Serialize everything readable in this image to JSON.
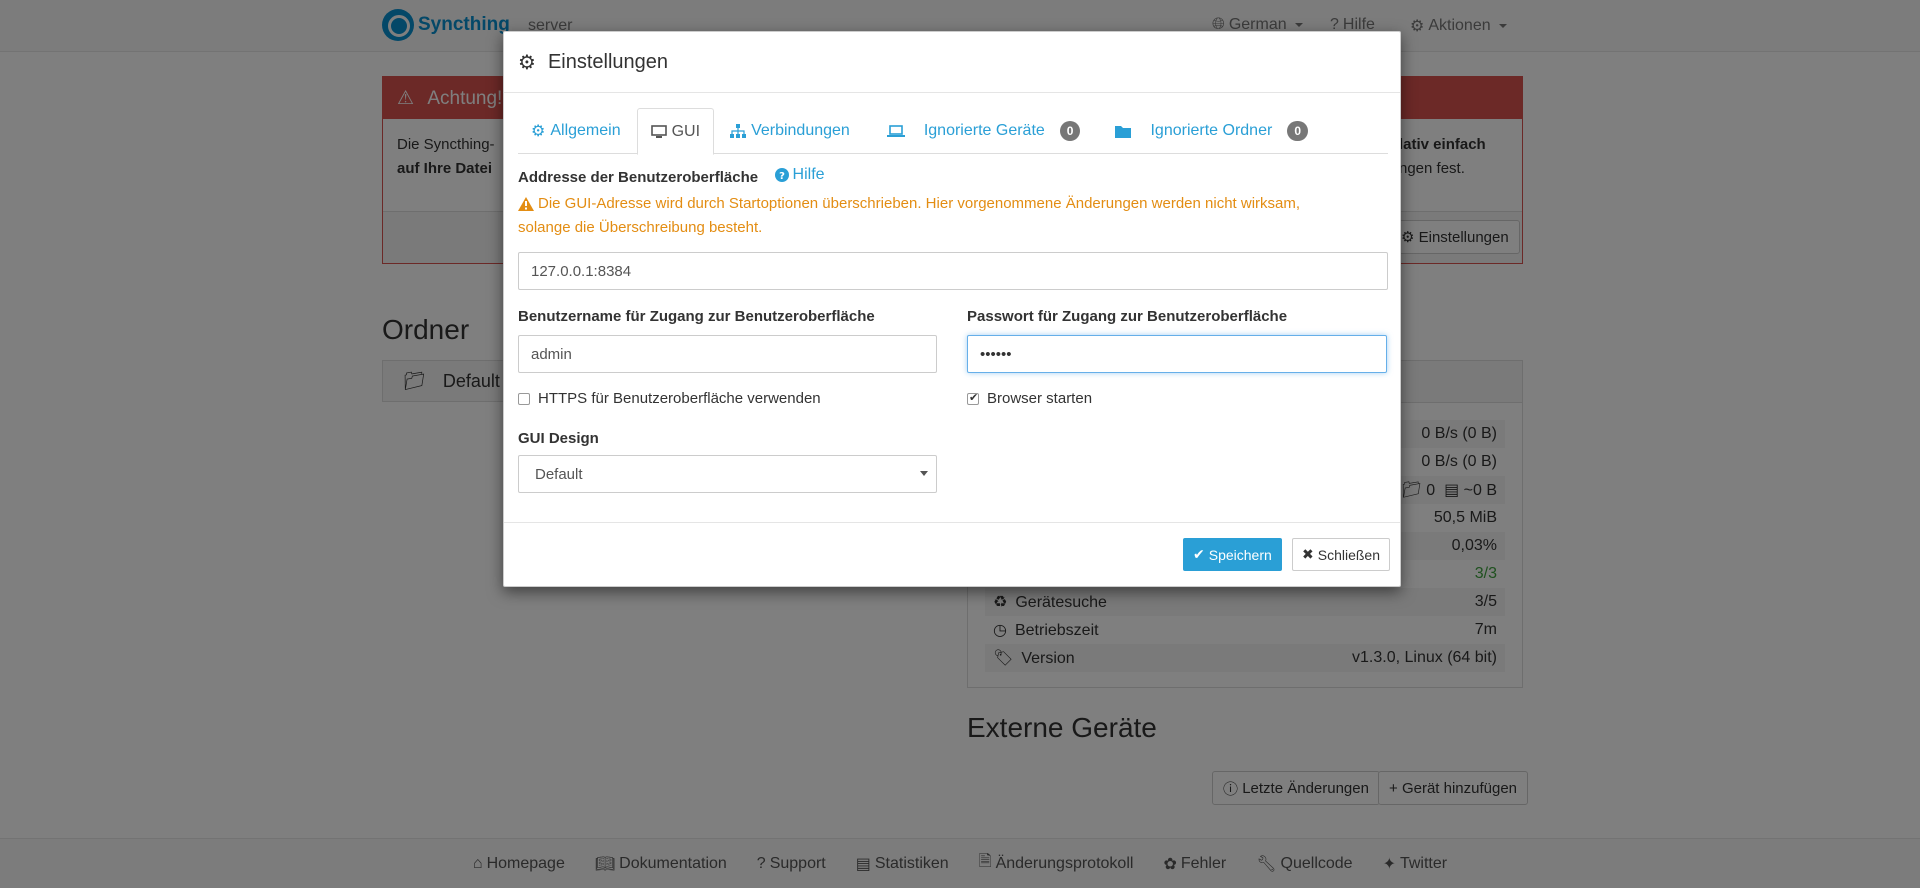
{
  "navbar": {
    "brand": "Syncthing",
    "host": "server",
    "language": "German",
    "help": "Hilfe",
    "actions": "Aktionen"
  },
  "alert": {
    "title": "Achtung!",
    "body_left_1": "Die Syncthing-",
    "body_left_2": "auf Ihre Datei",
    "body_right_1": "lativ einfach",
    "body_right_2": "ngen fest.",
    "settings_button": "Einstellungen"
  },
  "folders": {
    "heading": "Ordner",
    "default_folder": "Default"
  },
  "device": {
    "rows": [
      {
        "label": "",
        "value": "0 B/s (0 B)"
      },
      {
        "label": "",
        "value": "0 B/s (0 B)"
      },
      {
        "label": "",
        "value": "0",
        "value2": "~0 B"
      },
      {
        "label": "",
        "value": "50,5 MiB"
      },
      {
        "label": "",
        "value": "0,03%"
      },
      {
        "label": "",
        "value": "3/3"
      },
      {
        "label": "Gerätesuche",
        "value": "3/5"
      },
      {
        "label": "Betriebszeit",
        "value": "7m"
      },
      {
        "label": "Version",
        "value": "v1.3.0, Linux (64 bit)"
      }
    ]
  },
  "remote": {
    "heading": "Externe Geräte",
    "recent_changes": "Letzte Änderungen",
    "add_device": "Gerät hinzufügen"
  },
  "footer": {
    "links": [
      "Homepage",
      "Dokumentation",
      "Support",
      "Statistiken",
      "Änderungsprotokoll",
      "Fehler",
      "Quellcode",
      "Twitter"
    ]
  },
  "modal": {
    "title": "Einstellungen",
    "tabs": [
      {
        "label": "Allgemein"
      },
      {
        "label": "GUI"
      },
      {
        "label": "Verbindungen"
      },
      {
        "label": "Ignorierte Geräte",
        "badge": "0"
      },
      {
        "label": "Ignorierte Ordner",
        "badge": "0"
      }
    ],
    "gui_address_label": "Addresse der Benutzeroberfläche",
    "help_link": "Hilfe",
    "warning_line1": "Die GUI-Adresse wird durch Startoptionen überschrieben. Hier vorgenommene Änderungen werden nicht wirksam,",
    "warning_line2": "solange die Überschreibung besteht.",
    "gui_address_value": "127.0.0.1:8384",
    "username_label": "Benutzername für Zugang zur Benutzeroberfläche",
    "username_value": "admin",
    "password_label": "Passwort für Zugang zur Benutzeroberfläche",
    "password_value": "••••••",
    "https_label": "HTTPS für Benutzeroberfläche verwenden",
    "https_checked": false,
    "browser_label": "Browser starten",
    "browser_checked": true,
    "theme_label": "GUI Design",
    "theme_value": "Default",
    "save_button": "Speichern",
    "close_button": "Schließen"
  },
  "colors": {
    "primary": "#2a9fd6",
    "warning": "#e38d13",
    "danger": "#d9534f",
    "success": "#3fa33f"
  }
}
